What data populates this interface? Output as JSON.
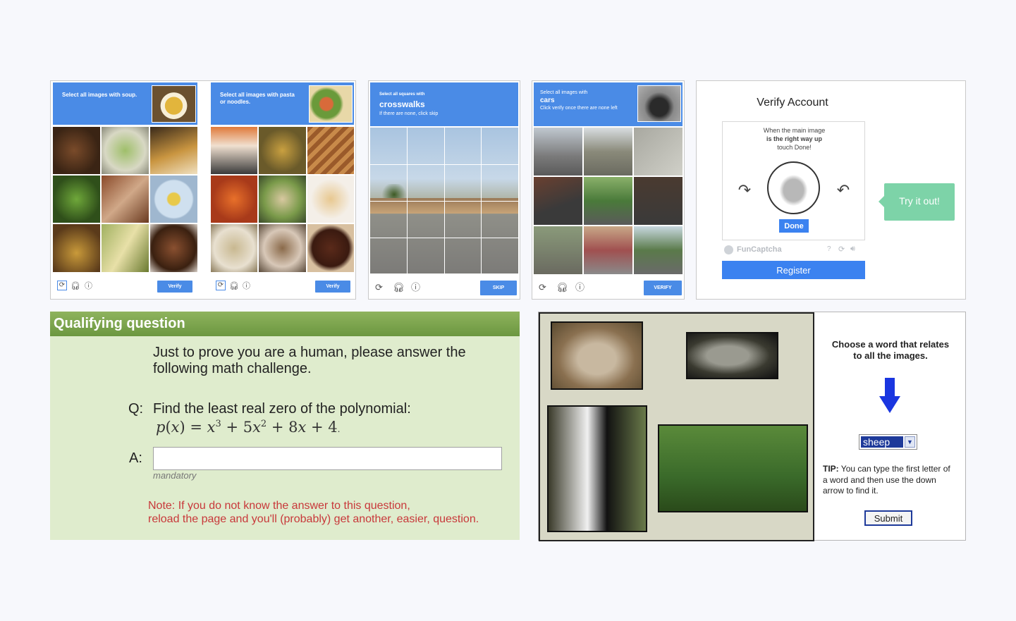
{
  "soup_captcha": {
    "prompt": "Select all images with soup.",
    "verify_label": "Verify"
  },
  "pasta_captcha": {
    "prompt": "Select all images with pasta or noodles.",
    "verify_label": "Verify"
  },
  "crosswalk_captcha": {
    "prefix": "Select all squares with",
    "target": "crosswalks",
    "hint": "If there are none, click skip",
    "skip_label": "SKIP"
  },
  "cars_captcha": {
    "prefix": "Select all images with",
    "target": "cars",
    "hint": "Click verify once there are none left",
    "verify_label": "VERIFY"
  },
  "funcaptcha": {
    "title": "Verify Account",
    "instruction_line1": "When the main image",
    "instruction_line2": "is the right way up",
    "instruction_line3": "touch Done!",
    "done_label": "Done",
    "brand": "FunCaptcha",
    "help": "?",
    "register_label": "Register",
    "try_label": "Try it out!"
  },
  "qualifying": {
    "header": "Qualifying question",
    "intro_line1": "Just to prove you are a human, please answer the",
    "intro_line2": "following math challenge.",
    "q_label": "Q:",
    "question": "Find the least real zero of the polynomial:",
    "a_label": "A:",
    "answer_value": "",
    "mandatory": "mandatory",
    "note_line1": "Note: If you do not know the answer to this question,",
    "note_line2": "reload the page and you'll (probably) get another, easier, question."
  },
  "word_captcha": {
    "instruction_line1": "Choose a word that relates",
    "instruction_line2": "to all the images.",
    "selected": "sheep",
    "tip_bold": "TIP:",
    "tip_line1": " You can type the first letter of",
    "tip_line2": "a word and then use the down",
    "tip_line3": "arrow to find it.",
    "submit_label": "Submit"
  },
  "colors": {
    "recaptcha_blue": "#4a8be6",
    "funcaptcha_blue": "#3b82f0",
    "try_green": "#7dd3a8",
    "qualify_bg": "#dfeccd",
    "qualify_header": "#7aa34b",
    "note_red": "#c8383a",
    "arrow_blue": "#1a36e0"
  },
  "icons": [
    "reload-icon",
    "audio-icon",
    "info-icon",
    "rotate-left-icon",
    "rotate-right-icon",
    "refresh-icon",
    "speaker-icon",
    "down-arrow-icon",
    "chevron-down-icon"
  ]
}
